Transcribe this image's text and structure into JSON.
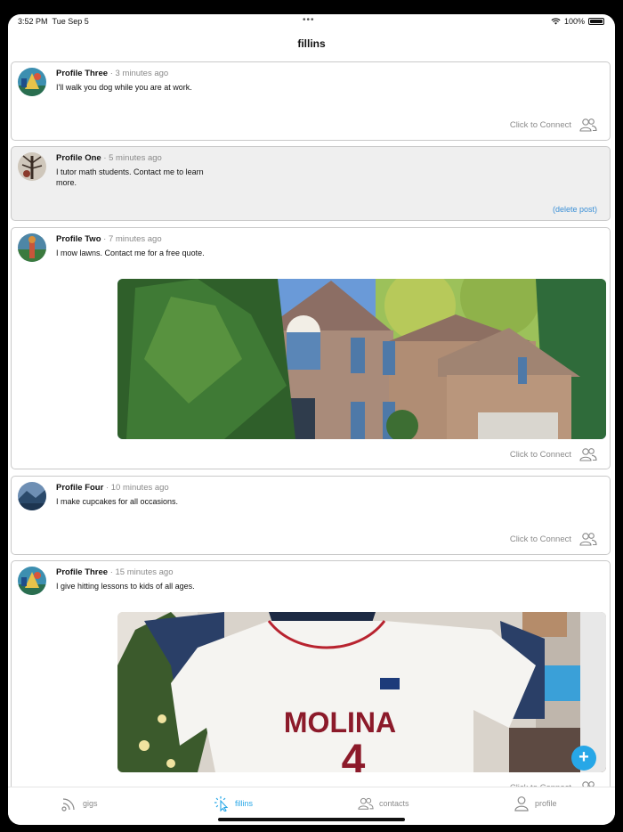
{
  "status": {
    "time": "3:52 PM",
    "date": "Tue Sep 5",
    "battery": "100%",
    "dots": "•••"
  },
  "title": "fillins",
  "posts": [
    {
      "name": "Profile Three",
      "ago": "· 3 minutes ago",
      "text": "I'll walk you dog while you are at work.",
      "action": "Click to Connect"
    },
    {
      "name": "Profile One",
      "ago": "· 5 minutes ago",
      "text": "I tutor math students. Contact me to learn more.",
      "action": "(delete post)"
    },
    {
      "name": "Profile Two",
      "ago": "· 7 minutes ago",
      "text": "I mow lawns. Contact me for a free quote.",
      "action": "Click to Connect"
    },
    {
      "name": "Profile Four",
      "ago": "· 10 minutes ago",
      "text": "I make cupcakes for all occasions.",
      "action": "Click to Connect"
    },
    {
      "name": "Profile Three",
      "ago": "· 15 minutes ago",
      "text": "I give hitting lessons to kids of all ages.",
      "action": "Click to Connect",
      "jersey_name": "MOLINA",
      "jersey_number": "4"
    }
  ],
  "fab": "+",
  "tabs": [
    {
      "label": "gigs",
      "icon": "rss-icon"
    },
    {
      "label": "fillins",
      "icon": "tap-cursor-icon",
      "active": true
    },
    {
      "label": "contacts",
      "icon": "people-icon"
    },
    {
      "label": "profile",
      "icon": "person-icon"
    }
  ],
  "colors": {
    "accent": "#27a7e7",
    "delete": "#3a8fd6",
    "muted": "#8a8a8a",
    "card_border": "#c9c9c9",
    "own_post_bg": "#efefef"
  }
}
